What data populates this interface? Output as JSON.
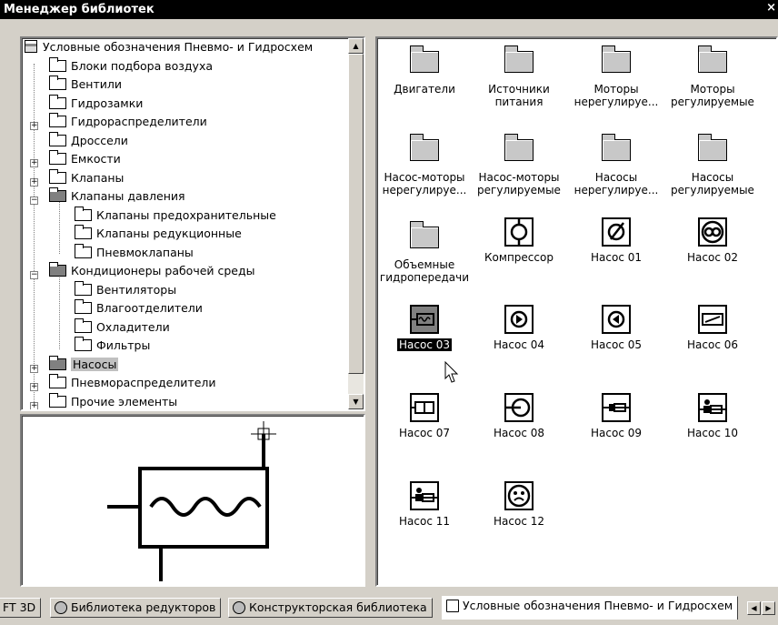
{
  "window": {
    "title": "Менеджер библиотек",
    "close": "×"
  },
  "tree": {
    "root": "Условные обозначения Пневмо- и Гидросхем",
    "items": [
      {
        "label": "Блоки подбора воздуха"
      },
      {
        "label": "Вентили"
      },
      {
        "label": "Гидрозамки"
      },
      {
        "label": "Гидрораспределители"
      },
      {
        "label": "Дроссели"
      },
      {
        "label": "Емкости"
      },
      {
        "label": "Клапаны"
      },
      {
        "label": "Клапаны давления"
      },
      {
        "label": "Клапаны предохранительные"
      },
      {
        "label": "Клапаны редукционные"
      },
      {
        "label": "Пневмоклапаны"
      },
      {
        "label": "Кондиционеры рабочей среды"
      },
      {
        "label": "Вентиляторы"
      },
      {
        "label": "Влагоотделители"
      },
      {
        "label": "Охладители"
      },
      {
        "label": "Фильтры"
      },
      {
        "label": "Насосы"
      },
      {
        "label": "Пневмораспределители"
      },
      {
        "label": "Прочие элементы"
      }
    ],
    "scroll_up": "▲",
    "scroll_down": "▼"
  },
  "icons": [
    {
      "label": "Двигатели"
    },
    {
      "label": "Источники питания"
    },
    {
      "label": "Моторы нерегулируе..."
    },
    {
      "label": "Моторы регулируемые"
    },
    {
      "label": "Насос-моторы нерегулируе..."
    },
    {
      "label": "Насос-моторы регулируемые"
    },
    {
      "label": "Насосы нерегулируе..."
    },
    {
      "label": "Насосы регулируемые"
    },
    {
      "label": "Объемные гидропередачи"
    },
    {
      "label": "Компрессор"
    },
    {
      "label": "Насос 01"
    },
    {
      "label": "Насос 02"
    },
    {
      "label": "Насос 03"
    },
    {
      "label": "Насос 04"
    },
    {
      "label": "Насос 05"
    },
    {
      "label": "Насос 06"
    },
    {
      "label": "Насос 07"
    },
    {
      "label": "Насос 08"
    },
    {
      "label": "Насос 09"
    },
    {
      "label": "Насос 10"
    },
    {
      "label": "Насос 11"
    },
    {
      "label": "Насос 12"
    }
  ],
  "tabs": [
    {
      "label": "FT 3D"
    },
    {
      "label": "Библиотека редукторов"
    },
    {
      "label": "Конструкторская библиотека"
    },
    {
      "label": "Условные обозначения Пневмо- и Гидросхем"
    }
  ],
  "tab_scroll": {
    "left": "◀",
    "right": "▶"
  }
}
